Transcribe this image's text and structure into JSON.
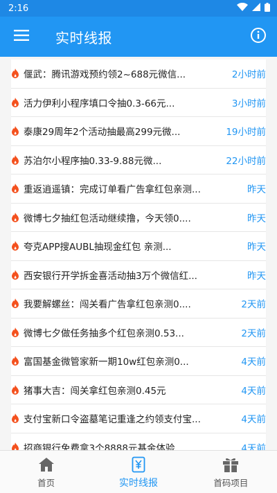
{
  "status_bar": {
    "time": "2:16"
  },
  "app_bar": {
    "title": "实时线报"
  },
  "colors": {
    "primary": "#2196f3",
    "status": "#1e88e5",
    "fire": "#f4511e"
  },
  "items": [
    {
      "title": "偃武：腾讯游戏预约领2~688元微信...",
      "time": "2小时前"
    },
    {
      "title": "活力伊利小程序填口令抽0.3-66元...",
      "time": "3小时前"
    },
    {
      "title": "泰康29周年2个活动抽最高299元微...",
      "time": "19小时前"
    },
    {
      "title": "苏泊尔小程序抽0.33-9.88元微...",
      "time": "22小时前"
    },
    {
      "title": "重返逍遥镇：完成订单看广告拿红包亲测...",
      "time": "昨天"
    },
    {
      "title": "微博七夕抽红包活动继续撸，今天领0....",
      "time": "昨天"
    },
    {
      "title": "夸克APP搜AUBL抽现金红包 亲测...",
      "time": "昨天"
    },
    {
      "title": "西安银行开学拆金喜活动抽3万个微信红...",
      "time": "昨天"
    },
    {
      "title": "我要解螺丝：闯关看广告拿红包亲测0....",
      "time": "2天前"
    },
    {
      "title": "微博七夕做任务抽多个红包亲测0.53...",
      "time": "2天前"
    },
    {
      "title": "富国基金微管家新一期10w红包亲测0...",
      "time": "4天前"
    },
    {
      "title": "猪事大吉：闯关拿红包亲测0.45元",
      "time": "4天前"
    },
    {
      "title": "支付宝新口令盗墓笔记重逢之约领支付宝...",
      "time": "4天前"
    },
    {
      "title": "招商银行免费拿3个8888元基金体验...",
      "time": "4天前"
    }
  ],
  "bottom_nav": [
    {
      "label": "首页",
      "icon": "home-icon"
    },
    {
      "label": "实时线报",
      "icon": "news-yen-icon"
    },
    {
      "label": "首码项目",
      "icon": "gift-icon"
    }
  ]
}
